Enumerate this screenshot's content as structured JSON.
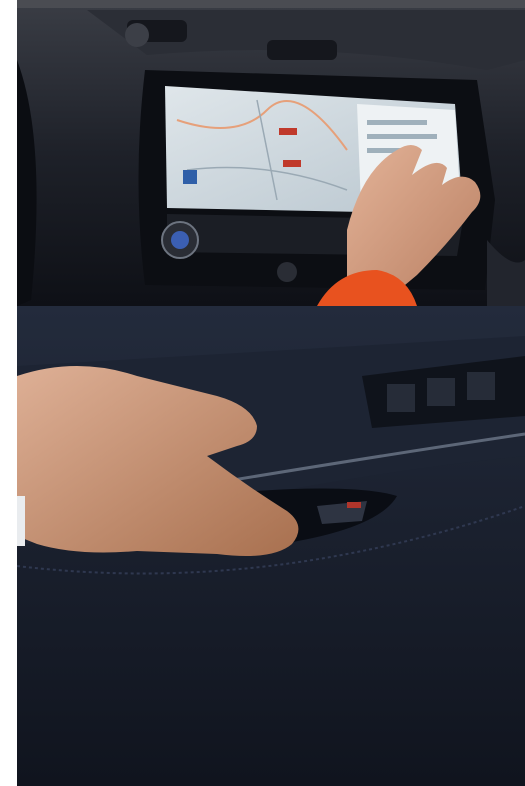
{
  "photos": [
    {
      "name": "dashboard-touchscreen-photo",
      "subject": "touchscreen-with-map"
    },
    {
      "name": "door-panel-photo",
      "subject": "door-handle-and-window-switches"
    }
  ],
  "colors": {
    "cabin_dark": "#161b26",
    "screen_light": "#c9d6df",
    "skin": "#d4a184",
    "sleeve": "#e8521f",
    "door_navy": "#1a2233"
  }
}
